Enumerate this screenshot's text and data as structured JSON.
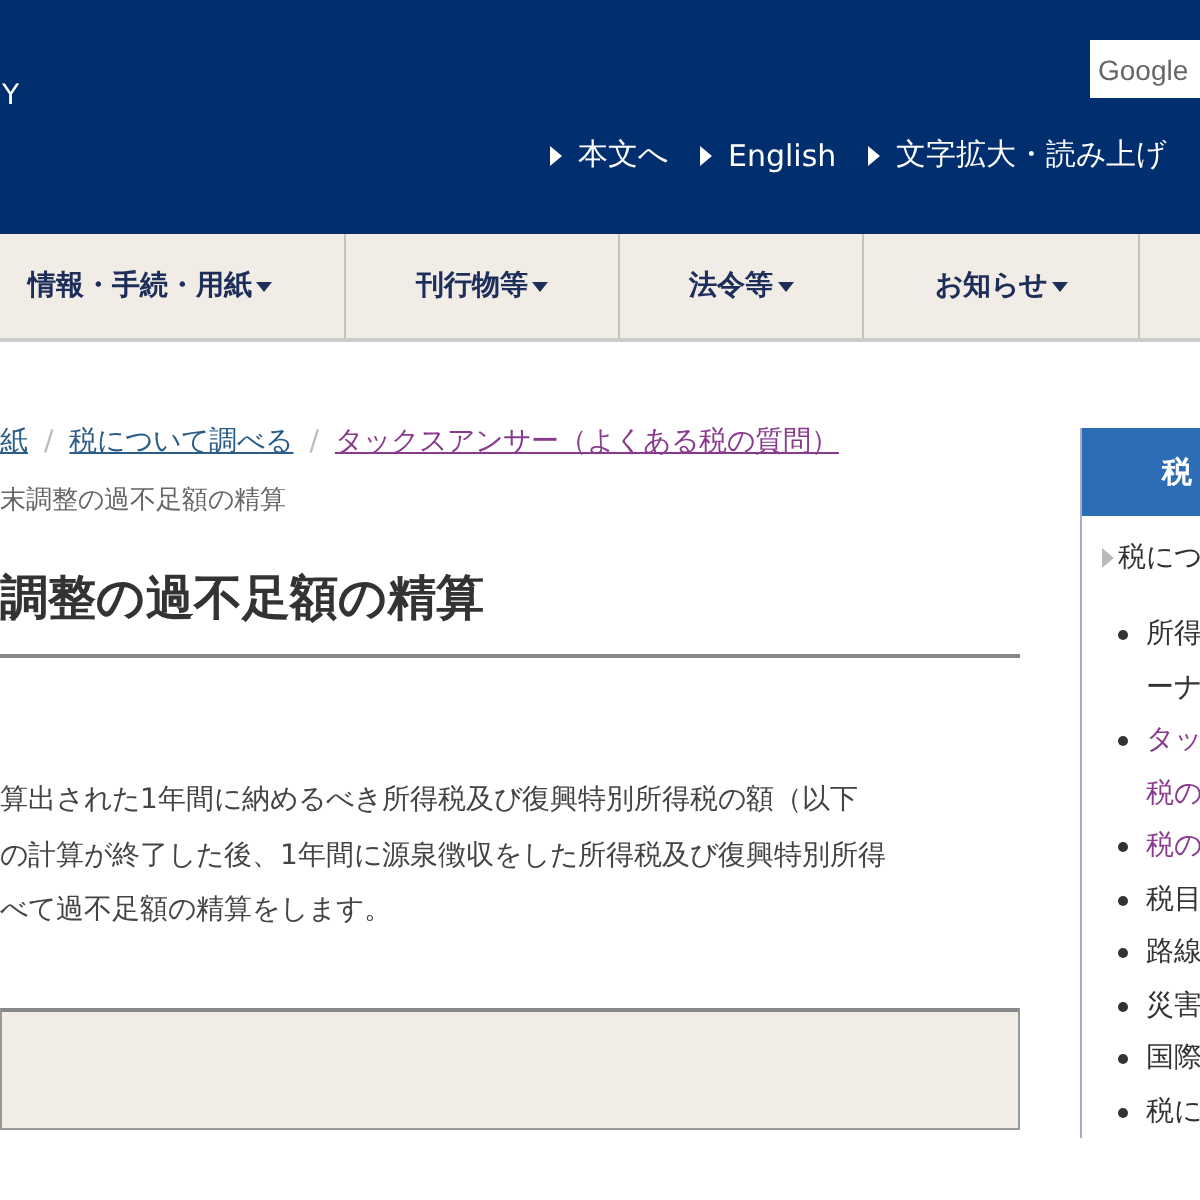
{
  "header": {
    "logo_text": "Y",
    "search_button": "Google",
    "links": [
      "本文へ",
      "English",
      "文字拡大・読み上げ"
    ]
  },
  "breadcrumb_separator": "/",
  "nav": [
    "情報・手続・用紙",
    "刊行物等",
    "法令等",
    "お知らせ"
  ],
  "breadcrumb": [
    {
      "label": "紙",
      "visited": false
    },
    {
      "label": "税について調べる",
      "visited": false
    },
    {
      "label": "タックスアンサー（よくある税の質問）",
      "visited": true
    }
  ],
  "current_page": "末調整の過不足額の精算",
  "title": "調整の過不足額の精算",
  "paragraph_lines": [
    "算出された1年間に納めるべき所得税及び復興特別所得税の額（以下",
    "の計算が終了した後、1年間に源泉徴収をした所得税及び復興特別所得",
    "べて過不足額の精算をします。"
  ],
  "sidebar": {
    "title": "税",
    "section_link": "税につ",
    "items": [
      {
        "lines": [
          "所得",
          "ーナ"
        ],
        "visited": false
      },
      {
        "lines": [
          "タッ",
          "税の"
        ],
        "visited": true
      },
      {
        "lines": [
          "税の"
        ],
        "visited": true
      },
      {
        "lines": [
          "税目"
        ],
        "visited": false
      },
      {
        "lines": [
          "路線"
        ],
        "visited": false
      },
      {
        "lines": [
          "災害"
        ],
        "visited": false
      },
      {
        "lines": [
          "国際"
        ],
        "visited": false
      },
      {
        "lines": [
          "税に"
        ],
        "visited": false
      }
    ]
  }
}
